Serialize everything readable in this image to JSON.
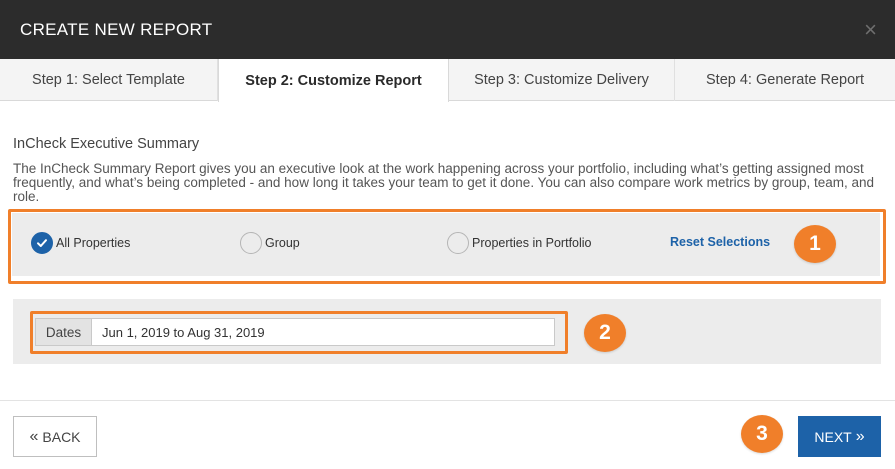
{
  "header": {
    "title": "CREATE NEW REPORT",
    "close_icon": "×"
  },
  "tabs": [
    {
      "label": "Step 1: Select Template",
      "active": false
    },
    {
      "label": "Step 2: Customize Report",
      "active": true
    },
    {
      "label": "Step 3: Customize Delivery",
      "active": false
    },
    {
      "label": "Step 4: Generate Report",
      "active": false
    }
  ],
  "report": {
    "title": "InCheck Executive Summary",
    "description": "The InCheck Summary Report gives you an executive look at the work happening across your portfolio, including what’s getting assigned most frequently, and what’s being completed - and how long it takes your team to get it done. You can also compare work metrics by group, team, and role."
  },
  "scope": {
    "options": [
      {
        "label": "All Properties",
        "selected": true
      },
      {
        "label": "Group",
        "selected": false
      },
      {
        "label": "Properties in Portfolio",
        "selected": false
      }
    ],
    "reset_label": "Reset Selections"
  },
  "dates": {
    "label": "Dates",
    "value": "Jun 1, 2019 to Aug 31, 2019"
  },
  "badges": [
    "1",
    "2",
    "3"
  ],
  "footer": {
    "back_label": "BACK",
    "back_icon": "«",
    "next_label": "NEXT",
    "next_icon": "»"
  },
  "colors": {
    "header_bg": "#2c2c2c",
    "accent_blue": "#1d62a8",
    "highlight_orange": "#f07f2a",
    "panel_gray": "#ececec"
  }
}
